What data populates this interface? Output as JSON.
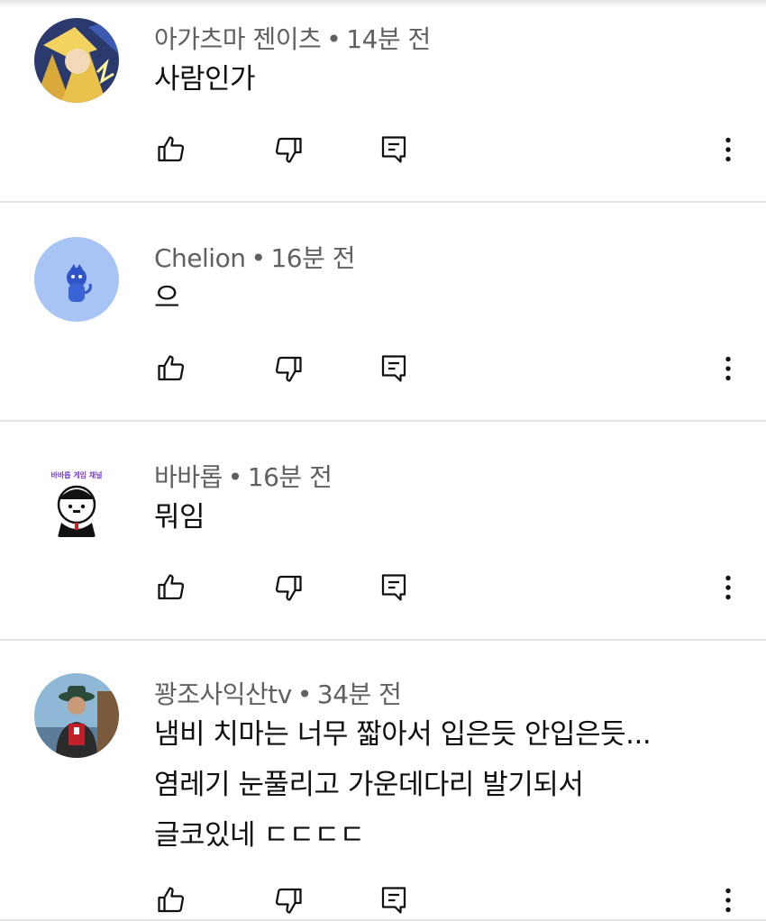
{
  "comments": [
    {
      "author": "아가츠마 젠이츠",
      "time": "14분 전",
      "text": "사람인가",
      "avatar": "anime-character-avatar"
    },
    {
      "author": "Chelion",
      "time": "16분 전",
      "text": "으",
      "avatar": "blue-creature-avatar"
    },
    {
      "author": "바바롭",
      "time": "16분 전",
      "text": "뭐임",
      "avatar": "cartoon-character-avatar",
      "avatar_caption": "바바롭 게임 채널"
    },
    {
      "author": "꽝조사익산tv",
      "time": "34분 전",
      "text": "냄비 치마는  너무 짧아서 입은듯  안입은듯...\n염레기 눈풀리고 가운데다리 발기되서\n글코있네 ㄷㄷㄷㄷ",
      "avatar": "fisherman-photo-avatar"
    }
  ],
  "icons": {
    "like": "thumbs-up-icon",
    "dislike": "thumbs-down-icon",
    "reply": "reply-icon",
    "more": "more-vert-icon"
  },
  "separator": "•",
  "colors": {
    "text": "#0f0f0f",
    "meta": "#606060",
    "divider": "#e3e3e3",
    "chelion_avatar_bg": "#a7c4f5"
  }
}
